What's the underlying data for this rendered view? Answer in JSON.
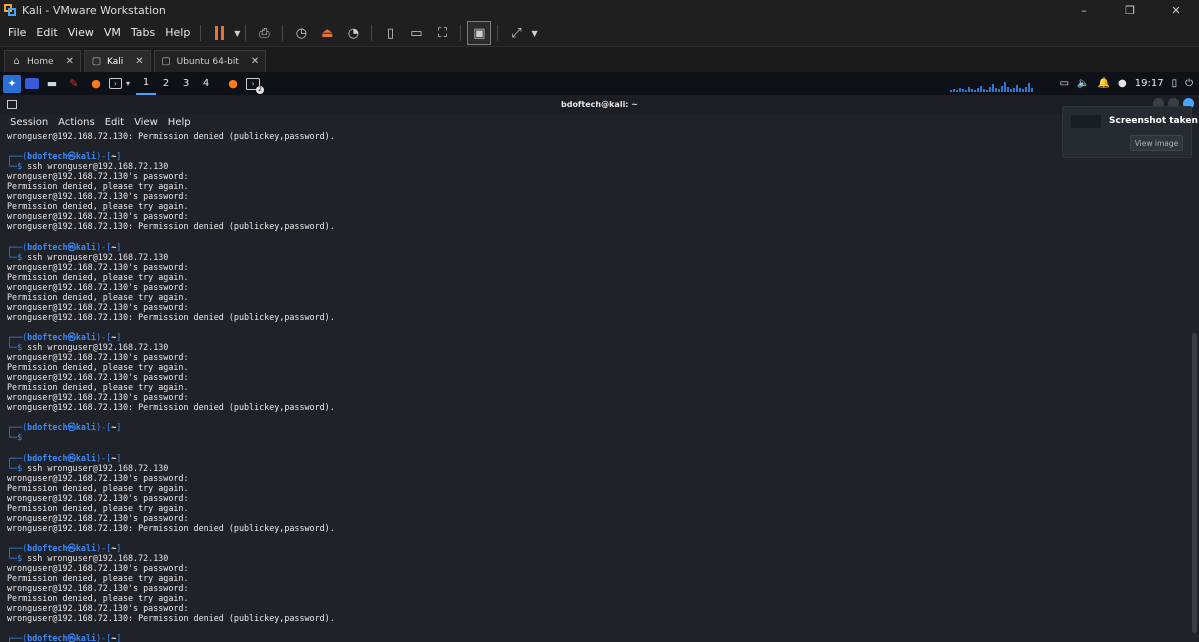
{
  "window": {
    "title": "Kali - VMware Workstation",
    "controls": [
      "–",
      "❐",
      "✕"
    ]
  },
  "menubar": {
    "items": [
      "File",
      "Edit",
      "View",
      "VM",
      "Tabs",
      "Help"
    ]
  },
  "tabs": [
    {
      "label": "Home",
      "icon": "home-icon"
    },
    {
      "label": "Kali",
      "icon": "vm-icon",
      "active": true
    },
    {
      "label": "Ubuntu 64-bit",
      "icon": "vm-icon"
    }
  ],
  "kali_panel": {
    "workspaces": [
      "1",
      "2",
      "3",
      "4"
    ],
    "active_workspace": "1",
    "clock": "19:17",
    "terminal_badge": "2"
  },
  "terminal": {
    "title": "bdoftech@kali: ~",
    "menu": [
      "Session",
      "Actions",
      "Edit",
      "View",
      "Help"
    ],
    "prompt": {
      "user": "bdoftech",
      "at": "㉿",
      "host": "kali",
      "dir": "~",
      "symbol": "$"
    },
    "lines": [
      {
        "t": "out",
        "text": "wronguser@192.168.72.130: Permission denied (publickey,password)."
      },
      {
        "t": "blank"
      },
      {
        "t": "prompt1"
      },
      {
        "t": "prompt2",
        "cmd": "ssh wronguser@192.168.72.130"
      },
      {
        "t": "out",
        "text": "wronguser@192.168.72.130's password:"
      },
      {
        "t": "out",
        "text": "Permission denied, please try again."
      },
      {
        "t": "out",
        "text": "wronguser@192.168.72.130's password:"
      },
      {
        "t": "out",
        "text": "Permission denied, please try again."
      },
      {
        "t": "out",
        "text": "wronguser@192.168.72.130's password:"
      },
      {
        "t": "out",
        "text": "wronguser@192.168.72.130: Permission denied (publickey,password)."
      },
      {
        "t": "blank"
      },
      {
        "t": "prompt1"
      },
      {
        "t": "prompt2",
        "cmd": "ssh wronguser@192.168.72.130"
      },
      {
        "t": "out",
        "text": "wronguser@192.168.72.130's password:"
      },
      {
        "t": "out",
        "text": "Permission denied, please try again."
      },
      {
        "t": "out",
        "text": "wronguser@192.168.72.130's password:"
      },
      {
        "t": "out",
        "text": "Permission denied, please try again."
      },
      {
        "t": "out",
        "text": "wronguser@192.168.72.130's password:"
      },
      {
        "t": "out",
        "text": "wronguser@192.168.72.130: Permission denied (publickey,password)."
      },
      {
        "t": "blank"
      },
      {
        "t": "prompt1"
      },
      {
        "t": "prompt2",
        "cmd": "ssh wronguser@192.168.72.130"
      },
      {
        "t": "out",
        "text": "wronguser@192.168.72.130's password:"
      },
      {
        "t": "out",
        "text": "Permission denied, please try again."
      },
      {
        "t": "out",
        "text": "wronguser@192.168.72.130's password:"
      },
      {
        "t": "out",
        "text": "Permission denied, please try again."
      },
      {
        "t": "out",
        "text": "wronguser@192.168.72.130's password:"
      },
      {
        "t": "out",
        "text": "wronguser@192.168.72.130: Permission denied (publickey,password)."
      },
      {
        "t": "blank"
      },
      {
        "t": "prompt1"
      },
      {
        "t": "prompt2",
        "cmd": ""
      },
      {
        "t": "blank"
      },
      {
        "t": "prompt1"
      },
      {
        "t": "prompt2",
        "cmd": "ssh wronguser@192.168.72.130"
      },
      {
        "t": "out",
        "text": "wronguser@192.168.72.130's password:"
      },
      {
        "t": "out",
        "text": "Permission denied, please try again."
      },
      {
        "t": "out",
        "text": "wronguser@192.168.72.130's password:"
      },
      {
        "t": "out",
        "text": "Permission denied, please try again."
      },
      {
        "t": "out",
        "text": "wronguser@192.168.72.130's password:"
      },
      {
        "t": "out",
        "text": "wronguser@192.168.72.130: Permission denied (publickey,password)."
      },
      {
        "t": "blank"
      },
      {
        "t": "prompt1"
      },
      {
        "t": "prompt2",
        "cmd": "ssh wronguser@192.168.72.130"
      },
      {
        "t": "out",
        "text": "wronguser@192.168.72.130's password:"
      },
      {
        "t": "out",
        "text": "Permission denied, please try again."
      },
      {
        "t": "out",
        "text": "wronguser@192.168.72.130's password:"
      },
      {
        "t": "out",
        "text": "Permission denied, please try again."
      },
      {
        "t": "out",
        "text": "wronguser@192.168.72.130's password:"
      },
      {
        "t": "out",
        "text": "wronguser@192.168.72.130: Permission denied (publickey,password)."
      },
      {
        "t": "blank"
      },
      {
        "t": "prompt1"
      }
    ]
  },
  "notification": {
    "title": "Screenshot taken",
    "button": "View image"
  },
  "colors": {
    "prompt": "#3d8af7",
    "terminal_bg": "#1f2229",
    "accent": "#4aa3ff"
  }
}
